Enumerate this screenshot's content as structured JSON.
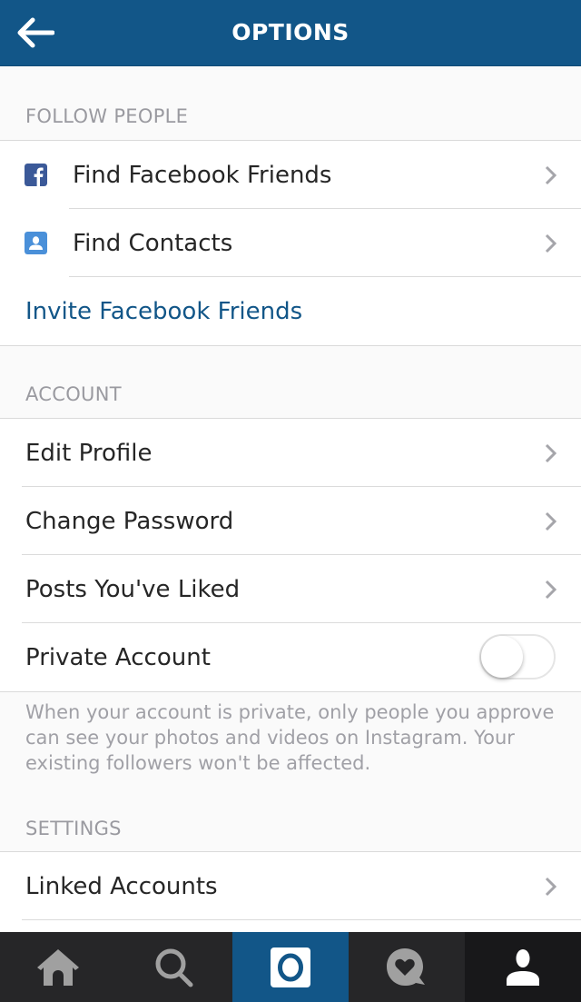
{
  "header": {
    "title": "OPTIONS",
    "back_icon": "arrow-left-icon"
  },
  "sections": {
    "follow_people": {
      "label": "FOLLOW PEOPLE",
      "items": [
        {
          "label": "Find Facebook Friends",
          "icon": "facebook-icon",
          "icon_color": "#3b5998"
        },
        {
          "label": "Find Contacts",
          "icon": "contact-icon",
          "icon_color": "#4a90d9"
        },
        {
          "label": "Invite Facebook Friends",
          "type": "link",
          "color": "#125688"
        }
      ]
    },
    "account": {
      "label": "ACCOUNT",
      "items": [
        {
          "label": "Edit Profile"
        },
        {
          "label": "Change Password"
        },
        {
          "label": "Posts You've Liked"
        },
        {
          "label": "Private Account",
          "type": "toggle",
          "value": false
        }
      ],
      "description": "When your account is private, only people you approve can see your photos and videos on Instagram. Your existing followers won't be affected."
    },
    "settings": {
      "label": "SETTINGS",
      "items": [
        {
          "label": "Linked Accounts"
        }
      ]
    }
  },
  "tabbar": {
    "tabs": [
      {
        "name": "home",
        "icon": "home-icon"
      },
      {
        "name": "search",
        "icon": "search-icon"
      },
      {
        "name": "camera",
        "icon": "camera-icon",
        "highlight": "#125688"
      },
      {
        "name": "activity",
        "icon": "heart-bubble-icon"
      },
      {
        "name": "profile",
        "icon": "profile-icon",
        "active": true
      }
    ]
  },
  "colors": {
    "brand": "#125688",
    "tabbar": "#262628",
    "text": "#262626",
    "section_label": "#9a9aa0"
  }
}
